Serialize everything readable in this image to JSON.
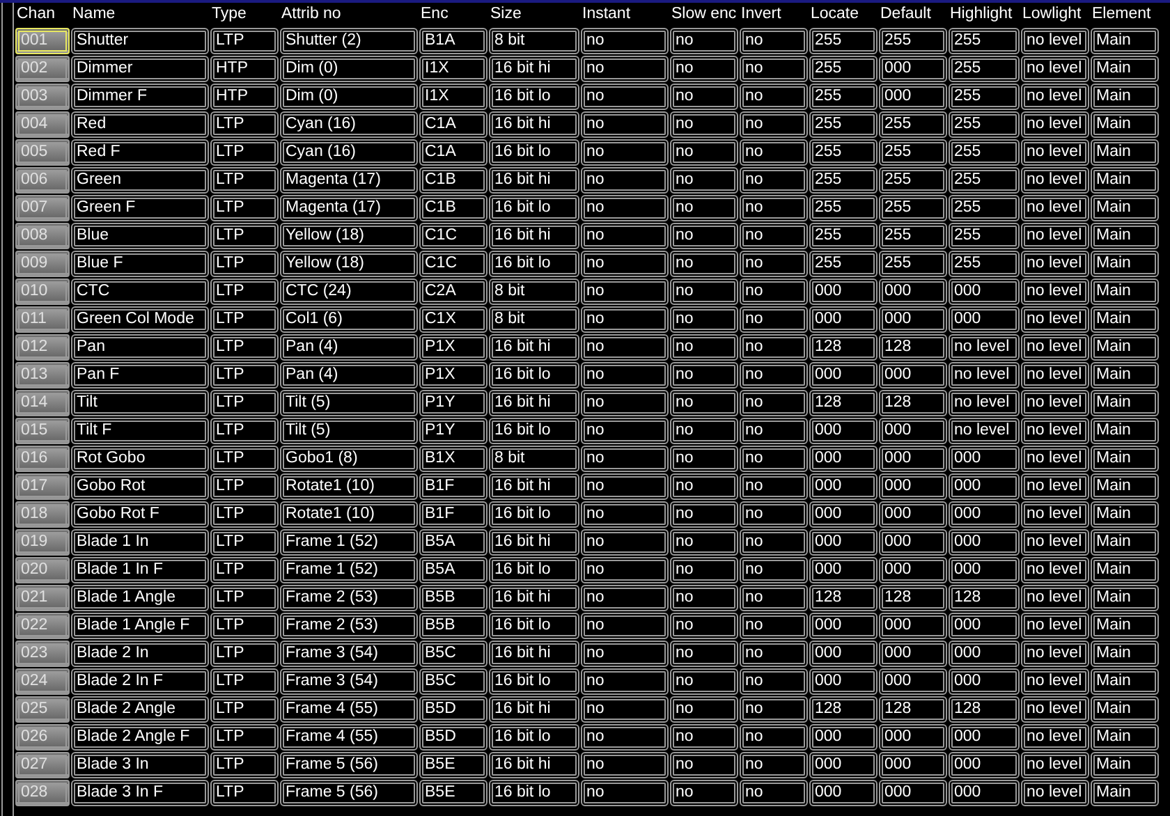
{
  "table": {
    "columns": [
      "Chan",
      "Name",
      "Type",
      "Attrib no",
      "Enc",
      "Size",
      "Instant",
      "Slow enc",
      "Invert",
      "Locate",
      "Default",
      "Highlight",
      "Lowlight",
      "Element"
    ],
    "rows": [
      {
        "selected": true,
        "cells": [
          "001",
          "Shutter",
          "LTP",
          "Shutter (2)",
          "B1A",
          "8 bit",
          "no",
          "no",
          "no",
          "255",
          "255",
          "255",
          "no level",
          "Main"
        ]
      },
      {
        "selected": false,
        "cells": [
          "002",
          "Dimmer",
          "HTP",
          "Dim (0)",
          "I1X",
          "16 bit hi",
          "no",
          "no",
          "no",
          "255",
          "000",
          "255",
          "no level",
          "Main"
        ]
      },
      {
        "selected": false,
        "cells": [
          "003",
          "Dimmer F",
          "HTP",
          "Dim (0)",
          "I1X",
          "16 bit lo",
          "no",
          "no",
          "no",
          "255",
          "000",
          "255",
          "no level",
          "Main"
        ]
      },
      {
        "selected": false,
        "cells": [
          "004",
          "Red",
          "LTP",
          "Cyan (16)",
          "C1A",
          "16 bit hi",
          "no",
          "no",
          "no",
          "255",
          "255",
          "255",
          "no level",
          "Main"
        ]
      },
      {
        "selected": false,
        "cells": [
          "005",
          "Red F",
          "LTP",
          "Cyan (16)",
          "C1A",
          "16 bit lo",
          "no",
          "no",
          "no",
          "255",
          "255",
          "255",
          "no level",
          "Main"
        ]
      },
      {
        "selected": false,
        "cells": [
          "006",
          "Green",
          "LTP",
          "Magenta (17)",
          "C1B",
          "16 bit hi",
          "no",
          "no",
          "no",
          "255",
          "255",
          "255",
          "no level",
          "Main"
        ]
      },
      {
        "selected": false,
        "cells": [
          "007",
          "Green F",
          "LTP",
          "Magenta (17)",
          "C1B",
          "16 bit lo",
          "no",
          "no",
          "no",
          "255",
          "255",
          "255",
          "no level",
          "Main"
        ]
      },
      {
        "selected": false,
        "cells": [
          "008",
          "Blue",
          "LTP",
          "Yellow (18)",
          "C1C",
          "16 bit hi",
          "no",
          "no",
          "no",
          "255",
          "255",
          "255",
          "no level",
          "Main"
        ]
      },
      {
        "selected": false,
        "cells": [
          "009",
          "Blue F",
          "LTP",
          "Yellow (18)",
          "C1C",
          "16 bit lo",
          "no",
          "no",
          "no",
          "255",
          "255",
          "255",
          "no level",
          "Main"
        ]
      },
      {
        "selected": false,
        "cells": [
          "010",
          "CTC",
          "LTP",
          "CTC (24)",
          "C2A",
          "8 bit",
          "no",
          "no",
          "no",
          "000",
          "000",
          "000",
          "no level",
          "Main"
        ]
      },
      {
        "selected": false,
        "cells": [
          "011",
          "Green Col Mode",
          "LTP",
          "Col1 (6)",
          "C1X",
          "8 bit",
          "no",
          "no",
          "no",
          "000",
          "000",
          "000",
          "no level",
          "Main"
        ]
      },
      {
        "selected": false,
        "cells": [
          "012",
          "Pan",
          "LTP",
          "Pan (4)",
          "P1X",
          "16 bit hi",
          "no",
          "no",
          "no",
          "128",
          "128",
          "no level",
          "no level",
          "Main"
        ]
      },
      {
        "selected": false,
        "cells": [
          "013",
          "Pan F",
          "LTP",
          "Pan (4)",
          "P1X",
          "16 bit lo",
          "no",
          "no",
          "no",
          "000",
          "000",
          "no level",
          "no level",
          "Main"
        ]
      },
      {
        "selected": false,
        "cells": [
          "014",
          "Tilt",
          "LTP",
          "Tilt (5)",
          "P1Y",
          "16 bit hi",
          "no",
          "no",
          "no",
          "128",
          "128",
          "no level",
          "no level",
          "Main"
        ]
      },
      {
        "selected": false,
        "cells": [
          "015",
          "Tilt F",
          "LTP",
          "Tilt (5)",
          "P1Y",
          "16 bit lo",
          "no",
          "no",
          "no",
          "000",
          "000",
          "no level",
          "no level",
          "Main"
        ]
      },
      {
        "selected": false,
        "cells": [
          "016",
          "Rot Gobo",
          "LTP",
          "Gobo1 (8)",
          "B1X",
          "8 bit",
          "no",
          "no",
          "no",
          "000",
          "000",
          "000",
          "no level",
          "Main"
        ]
      },
      {
        "selected": false,
        "cells": [
          "017",
          "Gobo Rot",
          "LTP",
          "Rotate1 (10)",
          "B1F",
          "16 bit hi",
          "no",
          "no",
          "no",
          "000",
          "000",
          "000",
          "no level",
          "Main"
        ]
      },
      {
        "selected": false,
        "cells": [
          "018",
          "Gobo Rot F",
          "LTP",
          "Rotate1 (10)",
          "B1F",
          "16 bit lo",
          "no",
          "no",
          "no",
          "000",
          "000",
          "000",
          "no level",
          "Main"
        ]
      },
      {
        "selected": false,
        "cells": [
          "019",
          "Blade 1 In",
          "LTP",
          "Frame 1 (52)",
          "B5A",
          "16 bit hi",
          "no",
          "no",
          "no",
          "000",
          "000",
          "000",
          "no level",
          "Main"
        ]
      },
      {
        "selected": false,
        "cells": [
          "020",
          "Blade 1 In F",
          "LTP",
          "Frame 1 (52)",
          "B5A",
          "16 bit lo",
          "no",
          "no",
          "no",
          "000",
          "000",
          "000",
          "no level",
          "Main"
        ]
      },
      {
        "selected": false,
        "cells": [
          "021",
          "Blade 1 Angle",
          "LTP",
          "Frame 2 (53)",
          "B5B",
          "16 bit hi",
          "no",
          "no",
          "no",
          "128",
          "128",
          "128",
          "no level",
          "Main"
        ]
      },
      {
        "selected": false,
        "cells": [
          "022",
          "Blade 1 Angle F",
          "LTP",
          "Frame 2 (53)",
          "B5B",
          "16 bit lo",
          "no",
          "no",
          "no",
          "000",
          "000",
          "000",
          "no level",
          "Main"
        ]
      },
      {
        "selected": false,
        "cells": [
          "023",
          "Blade 2 In",
          "LTP",
          "Frame 3 (54)",
          "B5C",
          "16 bit hi",
          "no",
          "no",
          "no",
          "000",
          "000",
          "000",
          "no level",
          "Main"
        ]
      },
      {
        "selected": false,
        "cells": [
          "024",
          "Blade 2 In F",
          "LTP",
          "Frame 3 (54)",
          "B5C",
          "16 bit lo",
          "no",
          "no",
          "no",
          "000",
          "000",
          "000",
          "no level",
          "Main"
        ]
      },
      {
        "selected": false,
        "cells": [
          "025",
          "Blade 2 Angle",
          "LTP",
          "Frame 4 (55)",
          "B5D",
          "16 bit hi",
          "no",
          "no",
          "no",
          "128",
          "128",
          "128",
          "no level",
          "Main"
        ]
      },
      {
        "selected": false,
        "cells": [
          "026",
          "Blade 2 Angle F",
          "LTP",
          "Frame 4 (55)",
          "B5D",
          "16 bit lo",
          "no",
          "no",
          "no",
          "000",
          "000",
          "000",
          "no level",
          "Main"
        ]
      },
      {
        "selected": false,
        "cells": [
          "027",
          "Blade 3 In",
          "LTP",
          "Frame 5 (56)",
          "B5E",
          "16 bit hi",
          "no",
          "no",
          "no",
          "000",
          "000",
          "000",
          "no level",
          "Main"
        ]
      },
      {
        "selected": false,
        "cells": [
          "028",
          "Blade 3 In F",
          "LTP",
          "Frame 5 (56)",
          "B5E",
          "16 bit lo",
          "no",
          "no",
          "no",
          "000",
          "000",
          "000",
          "no level",
          "Main"
        ]
      }
    ]
  }
}
